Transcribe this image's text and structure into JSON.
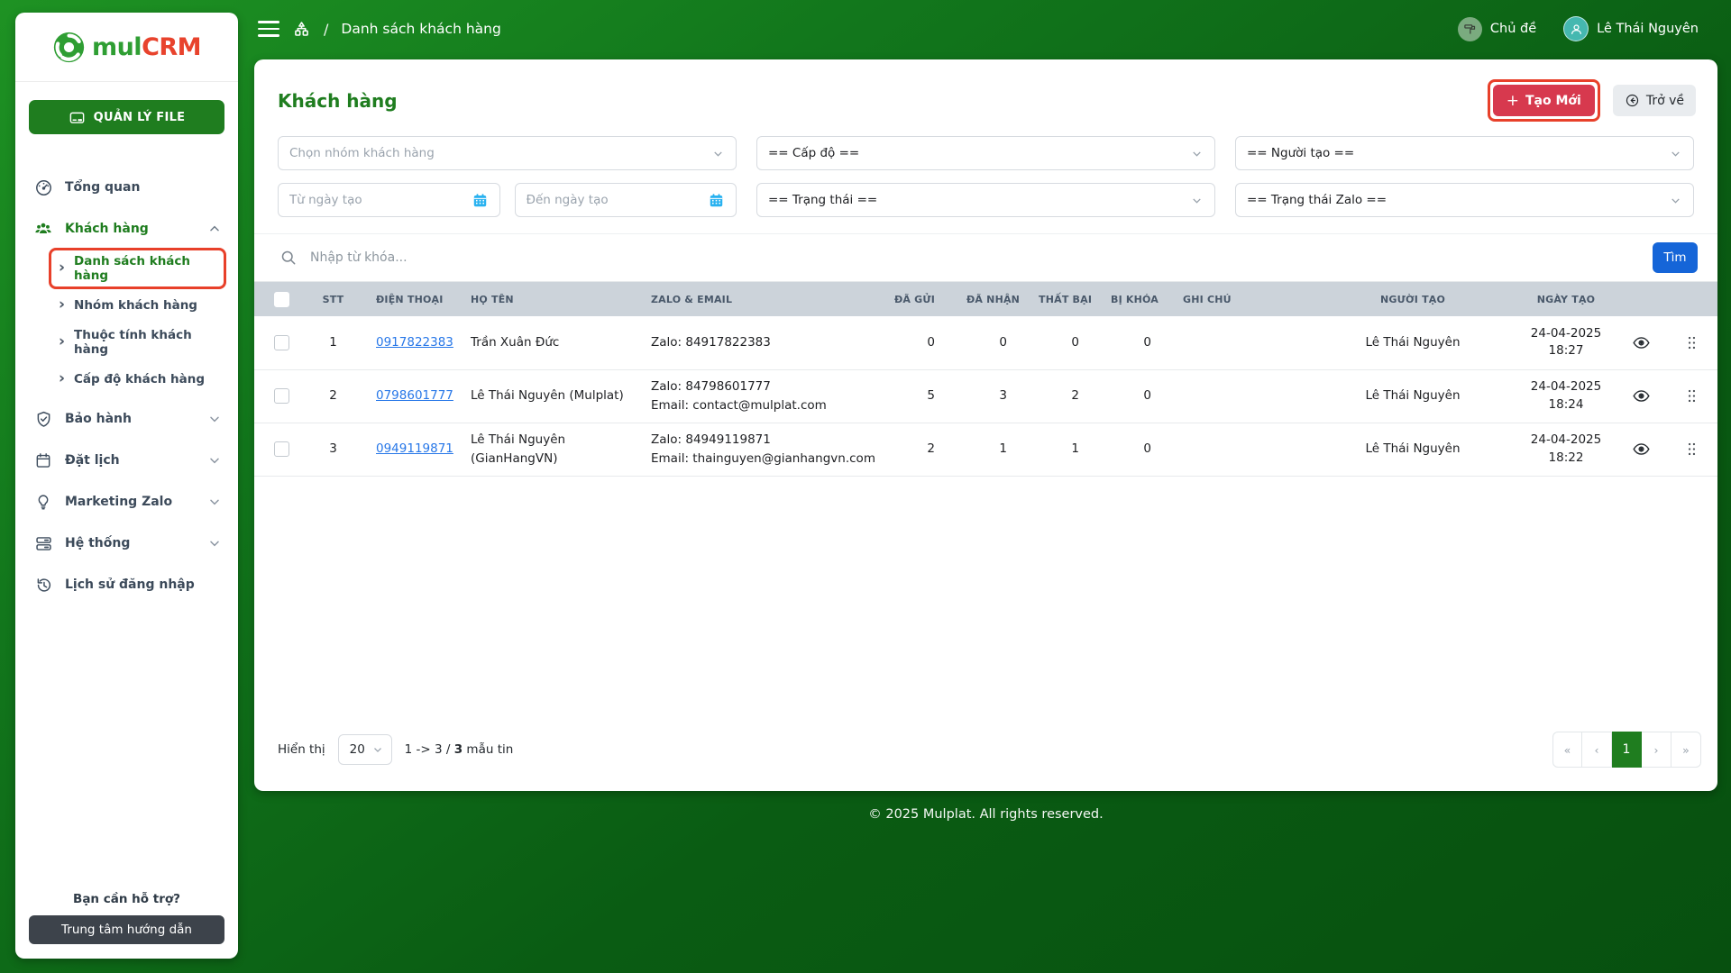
{
  "brand": {
    "name_prefix": "mul",
    "name_suffix": "CRM",
    "file_button": "QUẢN LÝ FILE"
  },
  "topbar": {
    "breadcrumb_separator": "/",
    "breadcrumb": "Danh sách khách hàng",
    "theme_label": "Chủ đề",
    "user_name": "Lê Thái Nguyên"
  },
  "sidebar": {
    "items": [
      {
        "label": "Tổng quan",
        "icon": "dashboard-icon"
      },
      {
        "label": "Khách hàng",
        "icon": "customers-icon",
        "active": true,
        "expanded": true,
        "children": [
          {
            "label": "Danh sách khách hàng",
            "active": true,
            "annotated": true
          },
          {
            "label": "Nhóm khách hàng"
          },
          {
            "label": "Thuộc tính khách hàng"
          },
          {
            "label": "Cấp độ khách hàng"
          }
        ]
      },
      {
        "label": "Bảo hành",
        "icon": "shield-icon",
        "collapsible": true
      },
      {
        "label": "Đặt lịch",
        "icon": "calendar-icon",
        "collapsible": true
      },
      {
        "label": "Marketing Zalo",
        "icon": "lightbulb-icon",
        "collapsible": true
      },
      {
        "label": "Hệ thống",
        "icon": "system-icon",
        "collapsible": true
      },
      {
        "label": "Lịch sử đăng nhập",
        "icon": "history-icon"
      }
    ],
    "help_text": "Bạn cần hỗ trợ?",
    "help_button": "Trung tâm hướng dẫn"
  },
  "page": {
    "title": "Khách hàng",
    "create_button": "Tạo Mới",
    "back_button": "Trở về"
  },
  "filters": {
    "group_placeholder": "Chọn nhóm khách hàng",
    "level": "== Cấp độ ==",
    "creator": "== Người tạo ==",
    "date_from_placeholder": "Từ ngày tạo",
    "date_to_placeholder": "Đến ngày tạo",
    "status": "== Trạng thái ==",
    "zalo_status": "== Trạng thái Zalo ==",
    "search_placeholder": "Nhập từ khóa...",
    "search_button": "Tìm"
  },
  "table": {
    "headers": [
      "STT",
      "ĐIỆN THOẠI",
      "HỌ TÊN",
      "ZALO & EMAIL",
      "ĐÃ GỬI",
      "ĐÃ NHẬN",
      "THẤT BẠI",
      "BỊ KHÓA",
      "GHI CHÚ",
      "NGƯỜI TẠO",
      "NGÀY TẠO"
    ],
    "rows": [
      {
        "stt": "1",
        "phone": "0917822383",
        "name": "Trần Xuân Đức",
        "zalo": "Zalo: 84917822383",
        "email": "",
        "sent": "0",
        "received": "0",
        "failed": "0",
        "locked": "0",
        "note": "",
        "creator": "Lê Thái Nguyên",
        "created_date": "24-04-2025",
        "created_time": "18:27"
      },
      {
        "stt": "2",
        "phone": "0798601777",
        "name": "Lê Thái Nguyên (Mulplat)",
        "zalo": "Zalo: 84798601777",
        "email": "Email: contact@mulplat.com",
        "sent": "5",
        "received": "3",
        "failed": "2",
        "locked": "0",
        "note": "",
        "creator": "Lê Thái Nguyên",
        "created_date": "24-04-2025",
        "created_time": "18:24"
      },
      {
        "stt": "3",
        "phone": "0949119871",
        "name": "Lê Thái Nguyên (GianHangVN)",
        "zalo": "Zalo: 84949119871",
        "email": "Email: thainguyen@gianhangvn.com",
        "sent": "2",
        "received": "1",
        "failed": "1",
        "locked": "0",
        "note": "",
        "creator": "Lê Thái Nguyên",
        "created_date": "24-04-2025",
        "created_time": "18:22"
      }
    ]
  },
  "pagination": {
    "show_label": "Hiển thị",
    "page_size": "20",
    "range_text": "1 -> 3 / ",
    "total_bold": "3",
    "records_label": " mẫu tin",
    "pages": [
      "«",
      "‹",
      "1",
      "›",
      "»"
    ],
    "current_page": "1"
  },
  "footer": {
    "copyright": "© 2025 Mulplat. All rights reserved."
  },
  "colors": {
    "accent_green": "#1f7d1f",
    "logo_green": "#2f9e33",
    "logo_red": "#e8432d",
    "danger_red": "#d7394e",
    "annotation_red": "#e8402a",
    "link_blue": "#2777e8",
    "primary_blue": "#1565d8",
    "table_header_bg": "#ccd3da"
  }
}
